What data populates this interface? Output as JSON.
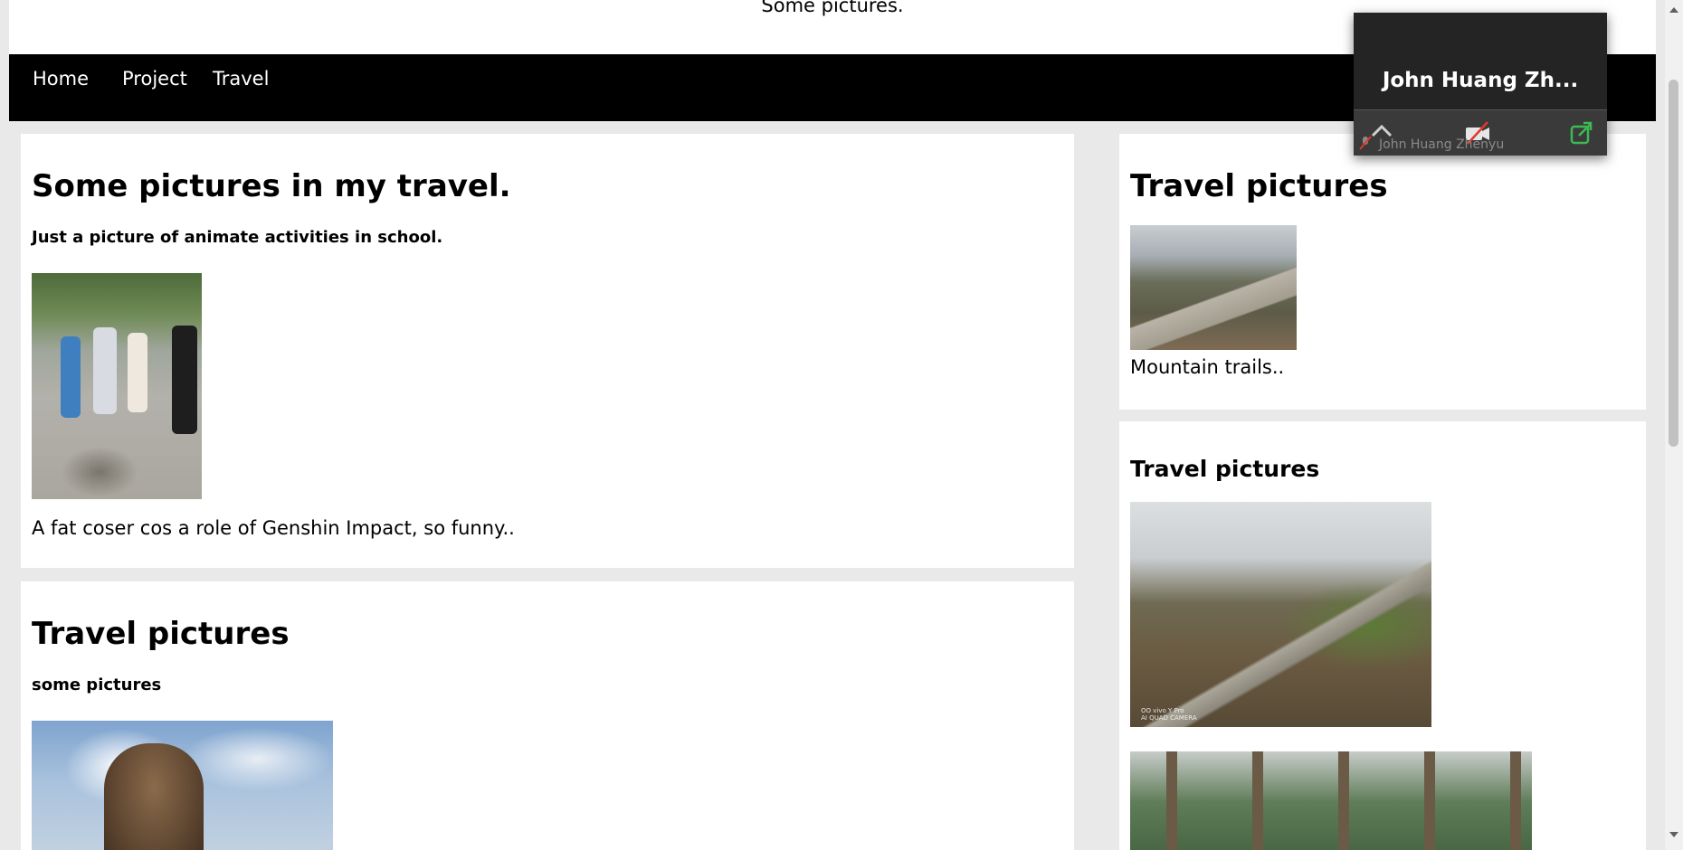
{
  "header": {
    "site_title": "Some pictures."
  },
  "nav": {
    "items": [
      "Home",
      "Project",
      "Travel"
    ]
  },
  "main": {
    "card1": {
      "title": "Some pictures in my travel.",
      "subtitle": "Just a picture of animate activities in school.",
      "caption": "A fat coser cos a role of Genshin Impact, so funny.."
    },
    "card2": {
      "title": "Travel pictures",
      "subtitle": "some pictures"
    }
  },
  "sidebar": {
    "card1": {
      "title": "Travel pictures",
      "caption": "Mountain trails.."
    },
    "card2": {
      "title": "Travel pictures"
    }
  },
  "photo_watermarks": [
    "OO vivo Y Pro\nAI QUAD CAMERA"
  ],
  "meeting": {
    "name_display": "John Huang Zh...",
    "name_full": "John Huang Zhenyu",
    "icons": [
      "chevron-up-icon",
      "camera-off-icon",
      "mic-off-icon",
      "external-link-icon"
    ]
  },
  "colors": {
    "nav_bg": "#000000",
    "page_bg": "#e9e9e9",
    "card_bg": "#ffffff",
    "popup_bg": "#242424",
    "accent_green": "#3cba54"
  }
}
